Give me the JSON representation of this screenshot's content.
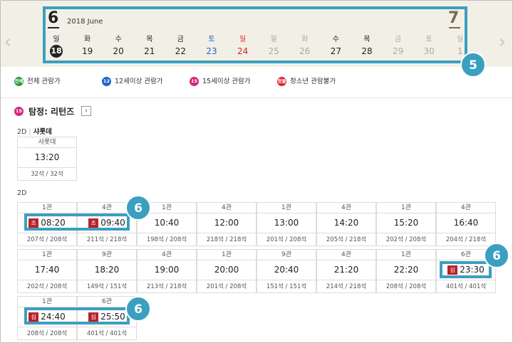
{
  "calendar": {
    "year_month": "2018 June",
    "current_month": "6",
    "next_month": "7",
    "days": [
      {
        "dow": "일",
        "day": "18",
        "kind": "today"
      },
      {
        "dow": "화",
        "day": "19",
        "kind": "normal"
      },
      {
        "dow": "수",
        "day": "20",
        "kind": "normal"
      },
      {
        "dow": "목",
        "day": "21",
        "kind": "normal"
      },
      {
        "dow": "금",
        "day": "22",
        "kind": "normal"
      },
      {
        "dow": "토",
        "day": "23",
        "kind": "sat"
      },
      {
        "dow": "일",
        "day": "24",
        "kind": "sun"
      },
      {
        "dow": "월",
        "day": "25",
        "kind": "dim"
      },
      {
        "dow": "화",
        "day": "26",
        "kind": "dim"
      },
      {
        "dow": "수",
        "day": "27",
        "kind": "normal"
      },
      {
        "dow": "목",
        "day": "28",
        "kind": "normal"
      },
      {
        "dow": "금",
        "day": "29",
        "kind": "dim"
      },
      {
        "dow": "토",
        "day": "30",
        "kind": "dim"
      },
      {
        "dow": "일",
        "day": "1",
        "kind": "dim"
      }
    ]
  },
  "markers": {
    "m5": "5",
    "m6a": "6",
    "m6b": "6",
    "m6c": "6"
  },
  "legend": {
    "all": {
      "icon": "전체",
      "label": "전체 관람가",
      "color": "#2e9a3c"
    },
    "age12": {
      "icon": "12",
      "label": "12세이상 관람가",
      "color": "#1b66c9"
    },
    "age15": {
      "icon": "15",
      "label": "15세이상 관람가",
      "color": "#d8277a"
    },
    "adult": {
      "icon": "청불",
      "label": "청소년 관람불가",
      "color": "#d9232e"
    }
  },
  "movie": {
    "rating_icon": "15",
    "title": "탐정: 리턴즈",
    "more": "›"
  },
  "section_charlotte": {
    "format": "2D",
    "hall_type": "샤롯데",
    "slot": {
      "hall": "샤롯데",
      "time": "13:20",
      "seats": "32석 / 32석"
    }
  },
  "section_2d": {
    "format": "2D",
    "slots": [
      {
        "hall": "1관",
        "time": "08:20",
        "badge": "조",
        "seats": "207석 / 208석"
      },
      {
        "hall": "4관",
        "time": "09:40",
        "badge": "조",
        "seats": "211석 / 218석"
      },
      {
        "hall": "1관",
        "time": "10:40",
        "badge": "",
        "seats": "198석 / 208석"
      },
      {
        "hall": "4관",
        "time": "12:00",
        "badge": "",
        "seats": "218석 / 218석"
      },
      {
        "hall": "1관",
        "time": "13:00",
        "badge": "",
        "seats": "201석 / 208석"
      },
      {
        "hall": "4관",
        "time": "14:20",
        "badge": "",
        "seats": "205석 / 218석"
      },
      {
        "hall": "1관",
        "time": "15:20",
        "badge": "",
        "seats": "202석 / 208석"
      },
      {
        "hall": "4관",
        "time": "16:40",
        "badge": "",
        "seats": "204석 / 218석"
      },
      {
        "hall": "1관",
        "time": "17:40",
        "badge": "",
        "seats": "202석 / 208석"
      },
      {
        "hall": "9관",
        "time": "18:20",
        "badge": "",
        "seats": "149석 / 151석"
      },
      {
        "hall": "4관",
        "time": "19:00",
        "badge": "",
        "seats": "213석 / 218석"
      },
      {
        "hall": "1관",
        "time": "20:00",
        "badge": "",
        "seats": "201석 / 208석"
      },
      {
        "hall": "9관",
        "time": "20:40",
        "badge": "",
        "seats": "151석 / 151석"
      },
      {
        "hall": "4관",
        "time": "21:20",
        "badge": "",
        "seats": "214석 / 218석"
      },
      {
        "hall": "1관",
        "time": "22:20",
        "badge": "",
        "seats": "208석 / 208석"
      },
      {
        "hall": "6관",
        "time": "23:30",
        "badge": "심",
        "seats": "401석 / 401석"
      },
      {
        "hall": "1관",
        "time": "24:40",
        "badge": "심",
        "seats": "208석 / 208석"
      },
      {
        "hall": "6관",
        "time": "25:50",
        "badge": "심",
        "seats": "401석 / 401석"
      }
    ]
  },
  "colors": {
    "highlight": "#3b9fc0",
    "badge": "#b8222a",
    "strip_bg": "#f2f0e6"
  }
}
